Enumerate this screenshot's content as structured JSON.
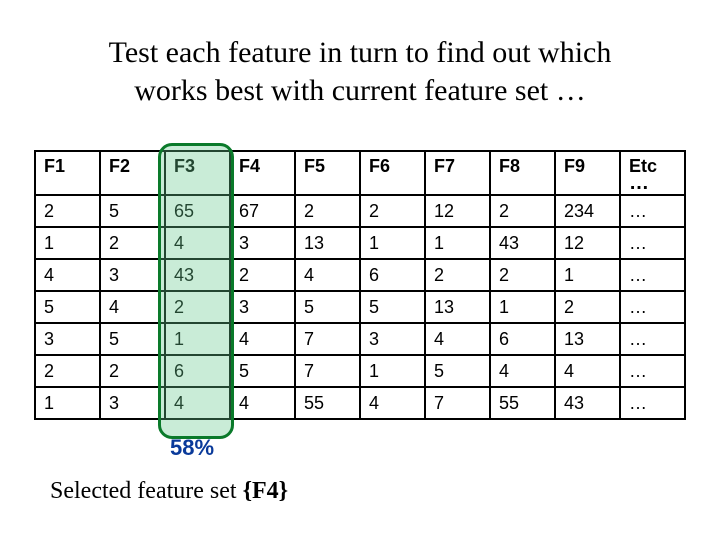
{
  "title_line1": "Test each feature in turn to find out which",
  "title_line2": "works best with current feature set …",
  "headers": [
    "F1",
    "F2",
    "F3",
    "F4",
    "F5",
    "F6",
    "F7",
    "F8",
    "F9",
    "Etc"
  ],
  "etc_dots": "…",
  "rows": [
    [
      "2",
      "5",
      "65",
      "67",
      "2",
      "2",
      "12",
      "2",
      "234",
      "…"
    ],
    [
      "1",
      "2",
      "4",
      "3",
      "13",
      "1",
      "1",
      "43",
      "12",
      "…"
    ],
    [
      "4",
      "3",
      "43",
      "2",
      "4",
      "6",
      "2",
      "2",
      "1",
      "…"
    ],
    [
      "5",
      "4",
      "2",
      "3",
      "5",
      "5",
      "13",
      "1",
      "2",
      "…"
    ],
    [
      "3",
      "5",
      "1",
      "4",
      "7",
      "3",
      "4",
      "6",
      "13",
      "…"
    ],
    [
      "2",
      "2",
      "6",
      "5",
      "7",
      "1",
      "5",
      "4",
      "4",
      "…"
    ],
    [
      "1",
      "3",
      "4",
      "4",
      "55",
      "4",
      "7",
      "55",
      "43",
      "…"
    ]
  ],
  "percent_label": "58%",
  "caption_prefix": "Selected feature set  ",
  "caption_set": "{F4}",
  "chart_data": {
    "type": "table",
    "title": "Test each feature in turn to find out which works best with current feature set …",
    "columns": [
      "F1",
      "F2",
      "F3",
      "F4",
      "F5",
      "F6",
      "F7",
      "F8",
      "F9",
      "Etc…"
    ],
    "data": [
      [
        2,
        5,
        65,
        67,
        2,
        2,
        12,
        2,
        234,
        null
      ],
      [
        1,
        2,
        4,
        3,
        13,
        1,
        1,
        43,
        12,
        null
      ],
      [
        4,
        3,
        43,
        2,
        4,
        6,
        2,
        2,
        1,
        null
      ],
      [
        5,
        4,
        2,
        3,
        5,
        5,
        13,
        1,
        2,
        null
      ],
      [
        3,
        5,
        1,
        4,
        7,
        3,
        4,
        6,
        13,
        null
      ],
      [
        2,
        2,
        6,
        5,
        7,
        1,
        5,
        4,
        4,
        null
      ],
      [
        1,
        3,
        4,
        4,
        55,
        4,
        7,
        55,
        43,
        null
      ]
    ],
    "highlighted_column": "F3",
    "highlighted_column_score_percent": 58,
    "selected_feature_set": [
      "F4"
    ]
  }
}
